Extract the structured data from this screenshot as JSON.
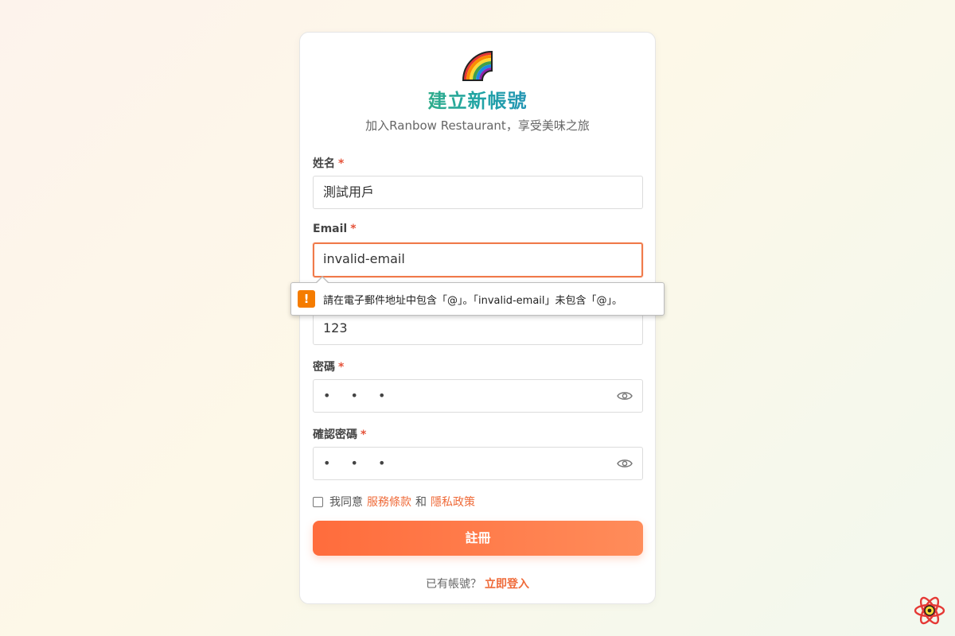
{
  "header": {
    "title": "建立新帳號",
    "subtitle": "加入Ranbow Restaurant，享受美味之旅",
    "logo_icon": "rainbow-icon"
  },
  "form": {
    "name": {
      "label": "姓名",
      "required": "*",
      "value": "測試用戶"
    },
    "email": {
      "label": "Email",
      "required": "*",
      "value": "invalid-email"
    },
    "phone": {
      "value": "123"
    },
    "password": {
      "label": "密碼",
      "required": "*",
      "value": "• • •",
      "toggle_icon": "eye-icon"
    },
    "confirm_password": {
      "label": "確認密碼",
      "required": "*",
      "value": "• • •",
      "toggle_icon": "eye-icon"
    },
    "agree": {
      "prefix": "我同意",
      "terms_link": "服務條款",
      "conjunction": "和",
      "privacy_link": "隱私政策",
      "checked": false
    },
    "submit_label": "註冊"
  },
  "validation_tooltip": {
    "icon": "warning-icon",
    "message": "請在電子郵件地址中包含「@」。「invalid-email」未包含「@」。"
  },
  "footer": {
    "prompt": "已有帳號？",
    "login_link": "立即登入"
  },
  "devtools": {
    "icon": "react-devtools-icon"
  },
  "colors": {
    "accent": "#ff6c3c",
    "error_border": "#f07a4a",
    "warning": "#f57c00"
  }
}
